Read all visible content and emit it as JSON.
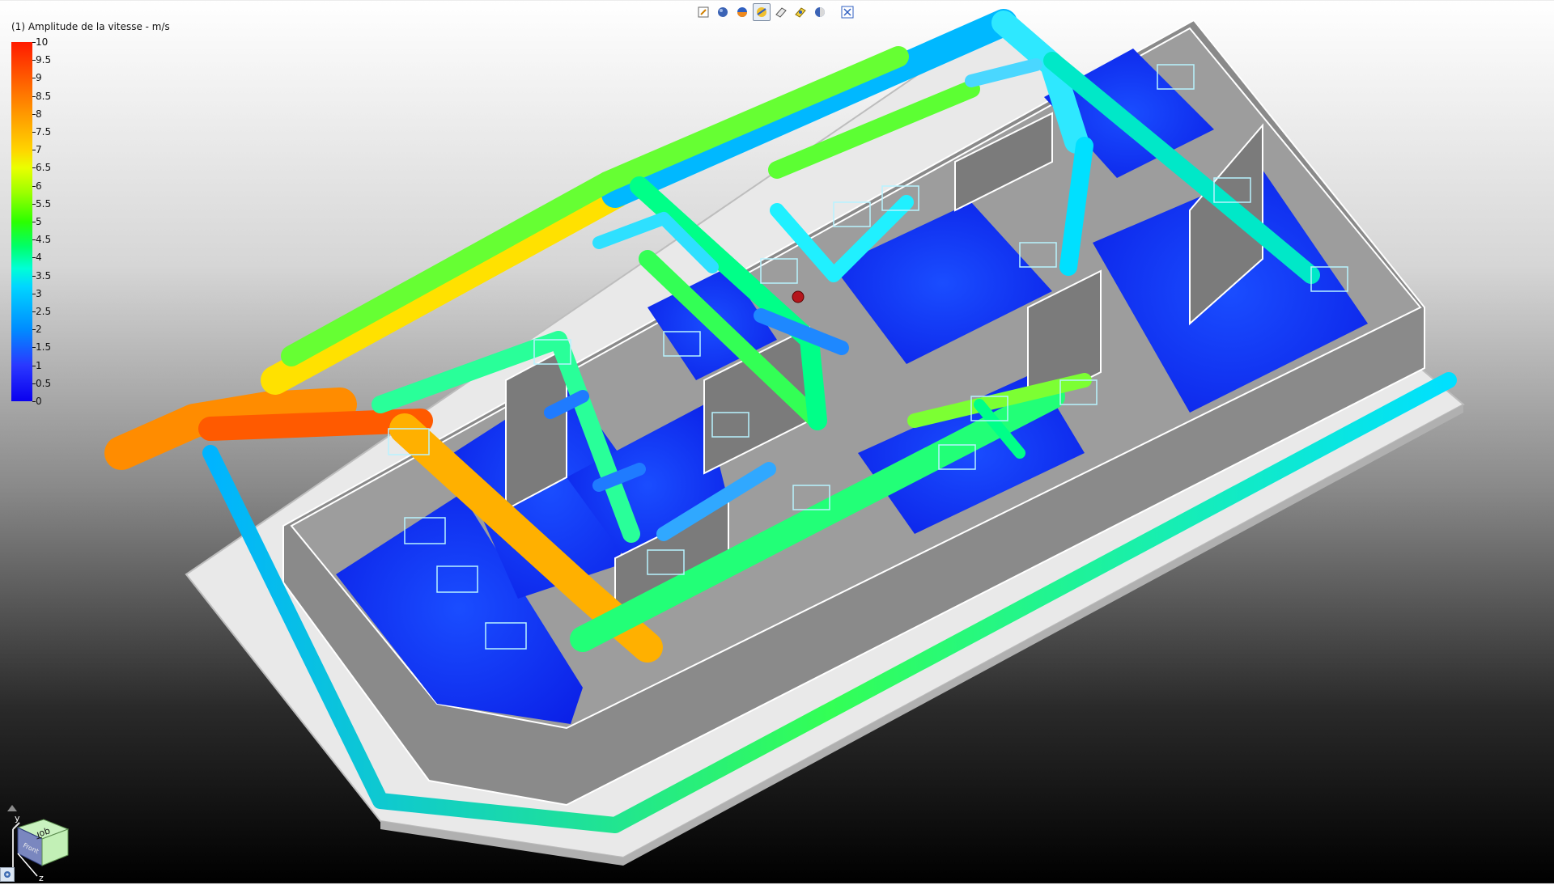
{
  "toolbar": {
    "buttons": [
      {
        "name": "edit-icon"
      },
      {
        "name": "shaded-icon"
      },
      {
        "name": "colored-shaded-icon"
      },
      {
        "name": "result-overlay-icon",
        "active": true
      },
      {
        "name": "section-plane-icon"
      },
      {
        "name": "iso-surface-icon"
      },
      {
        "name": "display-mode-icon"
      },
      {
        "name": "fit-view-icon"
      }
    ]
  },
  "legend": {
    "title": "(1) Amplitude de la vitesse - m/s",
    "ticks": [
      "10",
      "9.5",
      "9",
      "8.5",
      "8",
      "7.5",
      "7",
      "6.5",
      "6",
      "5.5",
      "5",
      "4.5",
      "4",
      "3.5",
      "3",
      "2.5",
      "2",
      "1.5",
      "1",
      "0.5",
      "0"
    ],
    "colors": [
      "#ff1a00",
      "#ff9800",
      "#eaff00",
      "#2cff00",
      "#00ffd6",
      "#008cff",
      "#0a00ee"
    ]
  },
  "nav_cube": {
    "face_top": "Top",
    "face_front": "Front",
    "axis_y": "y",
    "axis_z": "z"
  }
}
